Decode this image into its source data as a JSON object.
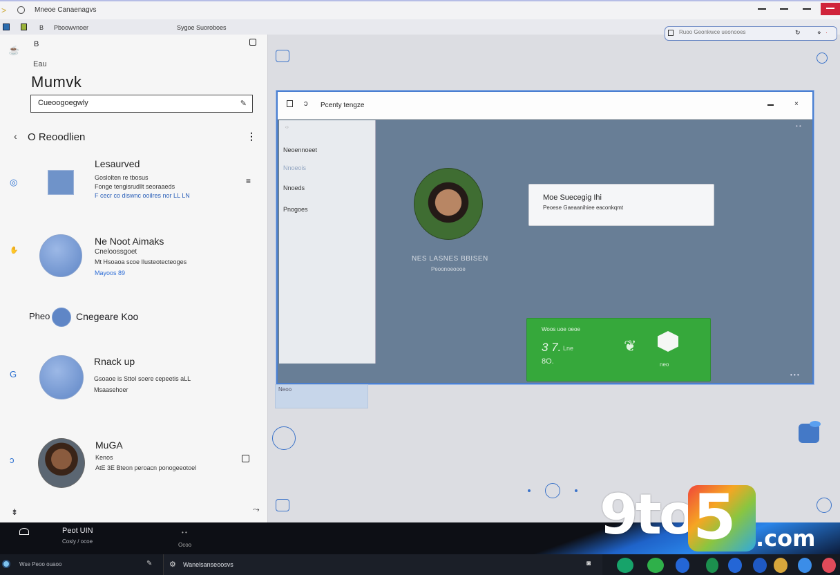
{
  "window": {
    "title": "Mneoe Canaenagvs"
  },
  "command_bar": {
    "item_a": "B",
    "item_b": "Pboowvnoer",
    "item_c": "Sygoe Suoroboes"
  },
  "search": {
    "placeholder": "Ruoo Geonkwce ueonooes"
  },
  "left_panel": {
    "top_letter": "B",
    "small_label": "Eau",
    "heading": "Mumvk",
    "input_value": "Cueoogoegwly",
    "section_label": "O Reoodlien",
    "items": [
      {
        "title": "Lesaurved",
        "lines": [
          "Goslolten re tbosus",
          "Fonge tengisrudllt seoraaeds",
          "F cecr co diswnc ooilres nor LL LN"
        ]
      },
      {
        "title": "Ne Noot Aimaks",
        "lines": [
          "Cneloossgoet",
          "Mt Hsoaoa scoe   Ilusteotecteoges"
        ],
        "link": "Mayoos 89"
      },
      {
        "title": "Rnack up",
        "lines": [
          "Gsoaoe is SttoI soere cepeetis  aLL",
          "Msaasehoer"
        ]
      },
      {
        "title": "MuGA",
        "lines": [
          "Kenos",
          "AtE 3E Bteon peroacn ponogeeotoel"
        ]
      }
    ],
    "pill": {
      "left": "Pheo",
      "right": "Cnegeare Koo"
    }
  },
  "inner_window": {
    "title": "Pcenty tengze",
    "sidebar": [
      "Neoennoeet",
      "Nnoeois",
      "Nnoeds",
      "Pnogoes"
    ],
    "profile_name": "NES LASNES BBISEN",
    "profile_sub": "Peoonoeoooe",
    "card": {
      "title": "Moe Suecegig Ihi",
      "subtitle": "Peoese Gaeaanihiee eaconkqmt"
    },
    "green_card": {
      "label": "Woos uoe oeoe",
      "value": "3 7.",
      "value_suffix": "Lne",
      "secondary": "8O.",
      "footer": "neo"
    },
    "corner_a": "• •",
    "corner_b": "• • •"
  },
  "ghost_label": "Neoo",
  "taskbar": {
    "label_a": "Peot UIN",
    "label_b": "Cosiy / ocoe",
    "label_c": "• •",
    "label_d": "Ocoo",
    "bottom_left": "Wse Peoo ouaoo",
    "bottom_mid": "Wanelsanseoosvs"
  },
  "watermark": {
    "lead": "9to",
    "digit": "5",
    "domain": ".com"
  },
  "colors": {
    "accent": "#3b73c9",
    "green_card": "#36a83b",
    "close_button": "#d0243b"
  },
  "icons": [
    "back-arrow-icon",
    "circle-icon",
    "minimize-icon",
    "maximize-icon",
    "close-icon",
    "search-icon",
    "pen-icon",
    "more-icon",
    "edge-icon",
    "mail-icon"
  ]
}
